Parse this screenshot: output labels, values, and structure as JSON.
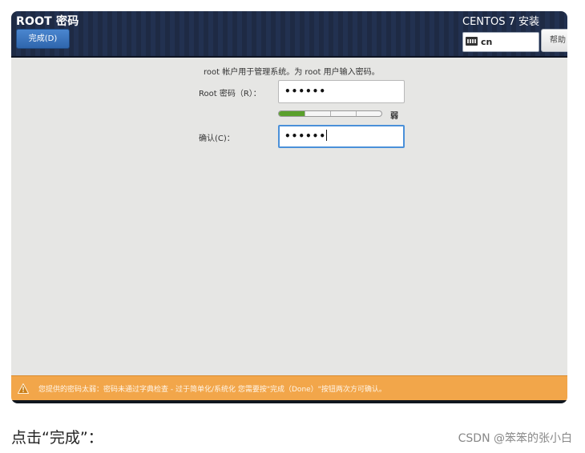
{
  "header": {
    "title": "ROOT 密码",
    "done_label": "完成(D)",
    "product": "CENTOS 7 安装",
    "keyboard_layout": "cn",
    "help_label": "帮助"
  },
  "form": {
    "description": "root 帐户用于管理系统。为 root 用户输入密码。",
    "root_label": "Root 密码（R）：",
    "root_value": "••••••",
    "strength_text": "弱",
    "strength_fraction": 0.25,
    "confirm_label": "确认(C)：",
    "confirm_value": "••••••"
  },
  "warning": {
    "text": "您提供的密码太弱：密码未通过字典检查 - 过于简单化/系统化 您需要按\"完成（Done）\"按钮两次方可确认。",
    "color": "#f2a64a"
  },
  "caption": "点击“完成”：",
  "watermark": "CSDN @笨笨的张小白"
}
